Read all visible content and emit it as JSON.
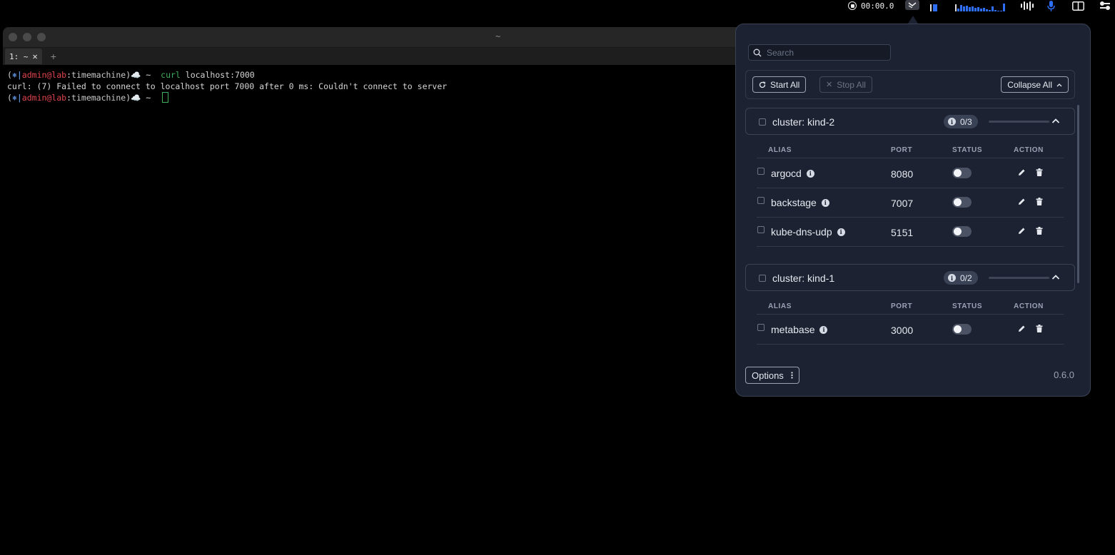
{
  "menubar": {
    "recording_time": "00:00.0",
    "icons": [
      "record-icon",
      "kftray-icon",
      "memory-icon",
      "cpu-graph-icon",
      "audio-wave-icon",
      "microphone-icon",
      "window-split-icon",
      "control-center-icon"
    ],
    "accent_color": "#2d6ef5"
  },
  "terminal": {
    "window_title": "~",
    "tab_label": "1: ~",
    "tab_close": "✕",
    "new_tab": "+",
    "lines": [
      {
        "prompt_open": "(",
        "prompt_glyph": "⎈|",
        "user": "admin@lab",
        "sep": ":",
        "context": "timemachine",
        "prompt_close": ")☁️ ~  ",
        "command": "curl",
        "args": " localhost:7000"
      },
      {
        "output": "curl: (7) Failed to connect to localhost port 7000 after 0 ms: Couldn't connect to server"
      },
      {
        "prompt_open": "(",
        "prompt_glyph": "⎈|",
        "user": "admin@lab",
        "sep": ":",
        "context": "timemachine",
        "prompt_close": ")☁️ ~  "
      }
    ]
  },
  "kftray": {
    "search_placeholder": "Search",
    "start_all": "Start All",
    "stop_all": "Stop All",
    "collapse_all": "Collapse All",
    "options": "Options",
    "version": "0.6.0",
    "columns": {
      "alias": "ALIAS",
      "port": "PORT",
      "status": "STATUS",
      "action": "ACTION"
    },
    "clusters": [
      {
        "name": "cluster: kind-2",
        "count": "0/3",
        "progress": 0,
        "rows": [
          {
            "alias": "argocd",
            "port": "8080",
            "status_on": false
          },
          {
            "alias": "backstage",
            "port": "7007",
            "status_on": false
          },
          {
            "alias": "kube-dns-udp",
            "port": "5151",
            "status_on": false
          }
        ]
      },
      {
        "name": "cluster: kind-1",
        "count": "0/2",
        "progress": 0,
        "rows": [
          {
            "alias": "metabase",
            "port": "3000",
            "status_on": false
          }
        ]
      }
    ]
  }
}
